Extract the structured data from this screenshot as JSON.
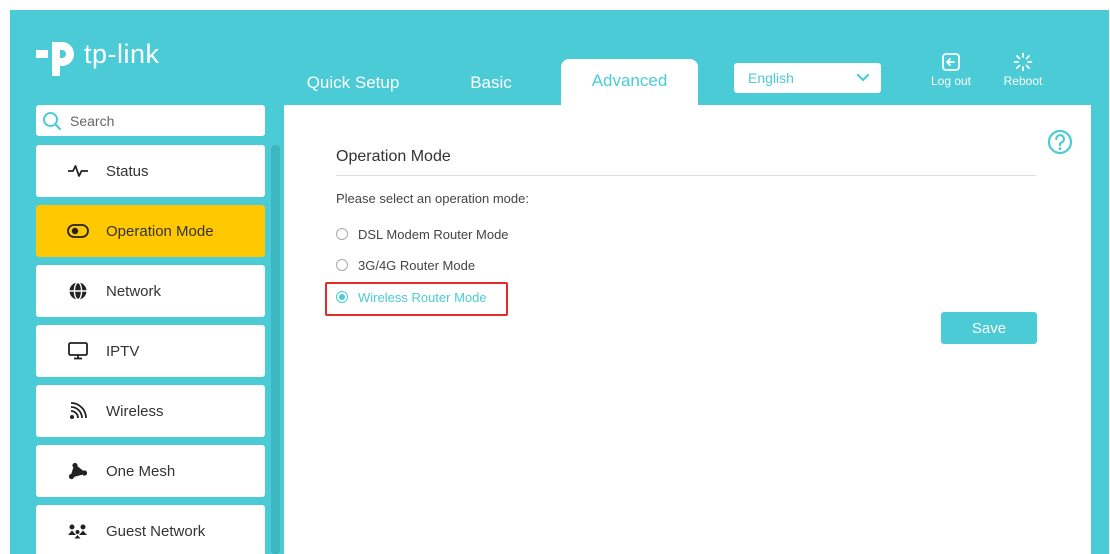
{
  "brand": {
    "logo_text": "tp-link"
  },
  "tabs": [
    {
      "label": "Quick Setup",
      "active": false
    },
    {
      "label": "Basic",
      "active": false
    },
    {
      "label": "Advanced",
      "active": true
    }
  ],
  "language": {
    "selected": "English"
  },
  "top_actions": {
    "logout_label": "Log out",
    "reboot_label": "Reboot"
  },
  "sidebar": {
    "search_placeholder": "Search",
    "items": [
      {
        "label": "Status",
        "icon": "pulse-icon",
        "active": false
      },
      {
        "label": "Operation Mode",
        "icon": "toggle-icon",
        "active": true
      },
      {
        "label": "Network",
        "icon": "globe-icon",
        "active": false
      },
      {
        "label": "IPTV",
        "icon": "monitor-icon",
        "active": false
      },
      {
        "label": "Wireless",
        "icon": "wifi-icon",
        "active": false
      },
      {
        "label": "One Mesh",
        "icon": "mesh-icon",
        "active": false
      },
      {
        "label": "Guest Network",
        "icon": "guest-users-icon",
        "active": false
      }
    ]
  },
  "main": {
    "section_title": "Operation Mode",
    "prompt": "Please select an operation mode:",
    "options": [
      {
        "label": "DSL Modem Router Mode",
        "selected": false
      },
      {
        "label": "3G/4G Router Mode",
        "selected": false
      },
      {
        "label": "Wireless Router Mode",
        "selected": true
      }
    ],
    "save_label": "Save"
  },
  "colors": {
    "brand": "#4acbd6",
    "active_nav": "#ffc800",
    "highlight": "#e52a2a"
  }
}
